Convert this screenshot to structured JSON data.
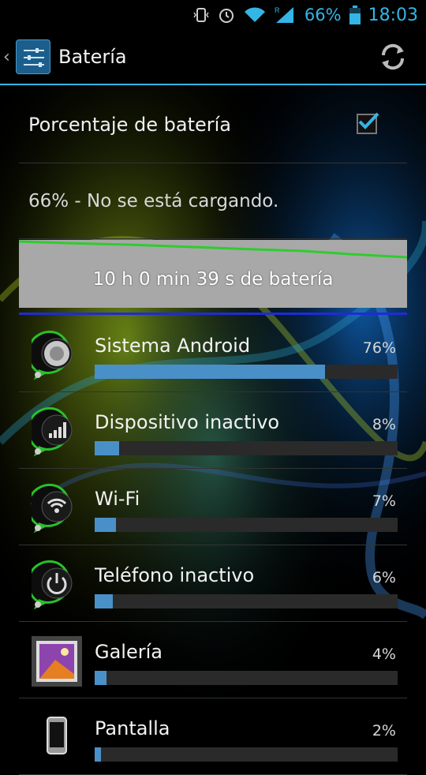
{
  "status_bar": {
    "battery_percent": "66%",
    "time": "18:03",
    "icons": [
      "vibrate-icon",
      "alarm-icon",
      "wifi-icon",
      "signal-icon",
      "battery-icon"
    ],
    "roaming_label": "R"
  },
  "action_bar": {
    "title": "Batería",
    "back_glyph": "‹",
    "refresh_icon": "refresh-icon",
    "accent": "#33b5e5"
  },
  "preference": {
    "label": "Porcentaje de batería",
    "checked": true
  },
  "battery_status": "66% - No se está cargando.",
  "graph": {
    "label": "10 h 0 min 39 s de batería",
    "line_color": "#2ecc2e",
    "bar_color": "#a8a8a8"
  },
  "usage": [
    {
      "name": "Sistema Android",
      "percent_label": "76%",
      "fraction": 0.76,
      "icon": "android-system-icon"
    },
    {
      "name": "Dispositivo inactivo",
      "percent_label": "8%",
      "fraction": 0.08,
      "icon": "cell-standby-icon"
    },
    {
      "name": "Wi-Fi",
      "percent_label": "7%",
      "fraction": 0.07,
      "icon": "wifi-icon"
    },
    {
      "name": "Teléfono inactivo",
      "percent_label": "6%",
      "fraction": 0.06,
      "icon": "power-icon"
    },
    {
      "name": "Galería",
      "percent_label": "4%",
      "fraction": 0.04,
      "icon": "gallery-icon"
    },
    {
      "name": "Pantalla",
      "percent_label": "2%",
      "fraction": 0.02,
      "icon": "phone-screen-icon"
    }
  ]
}
